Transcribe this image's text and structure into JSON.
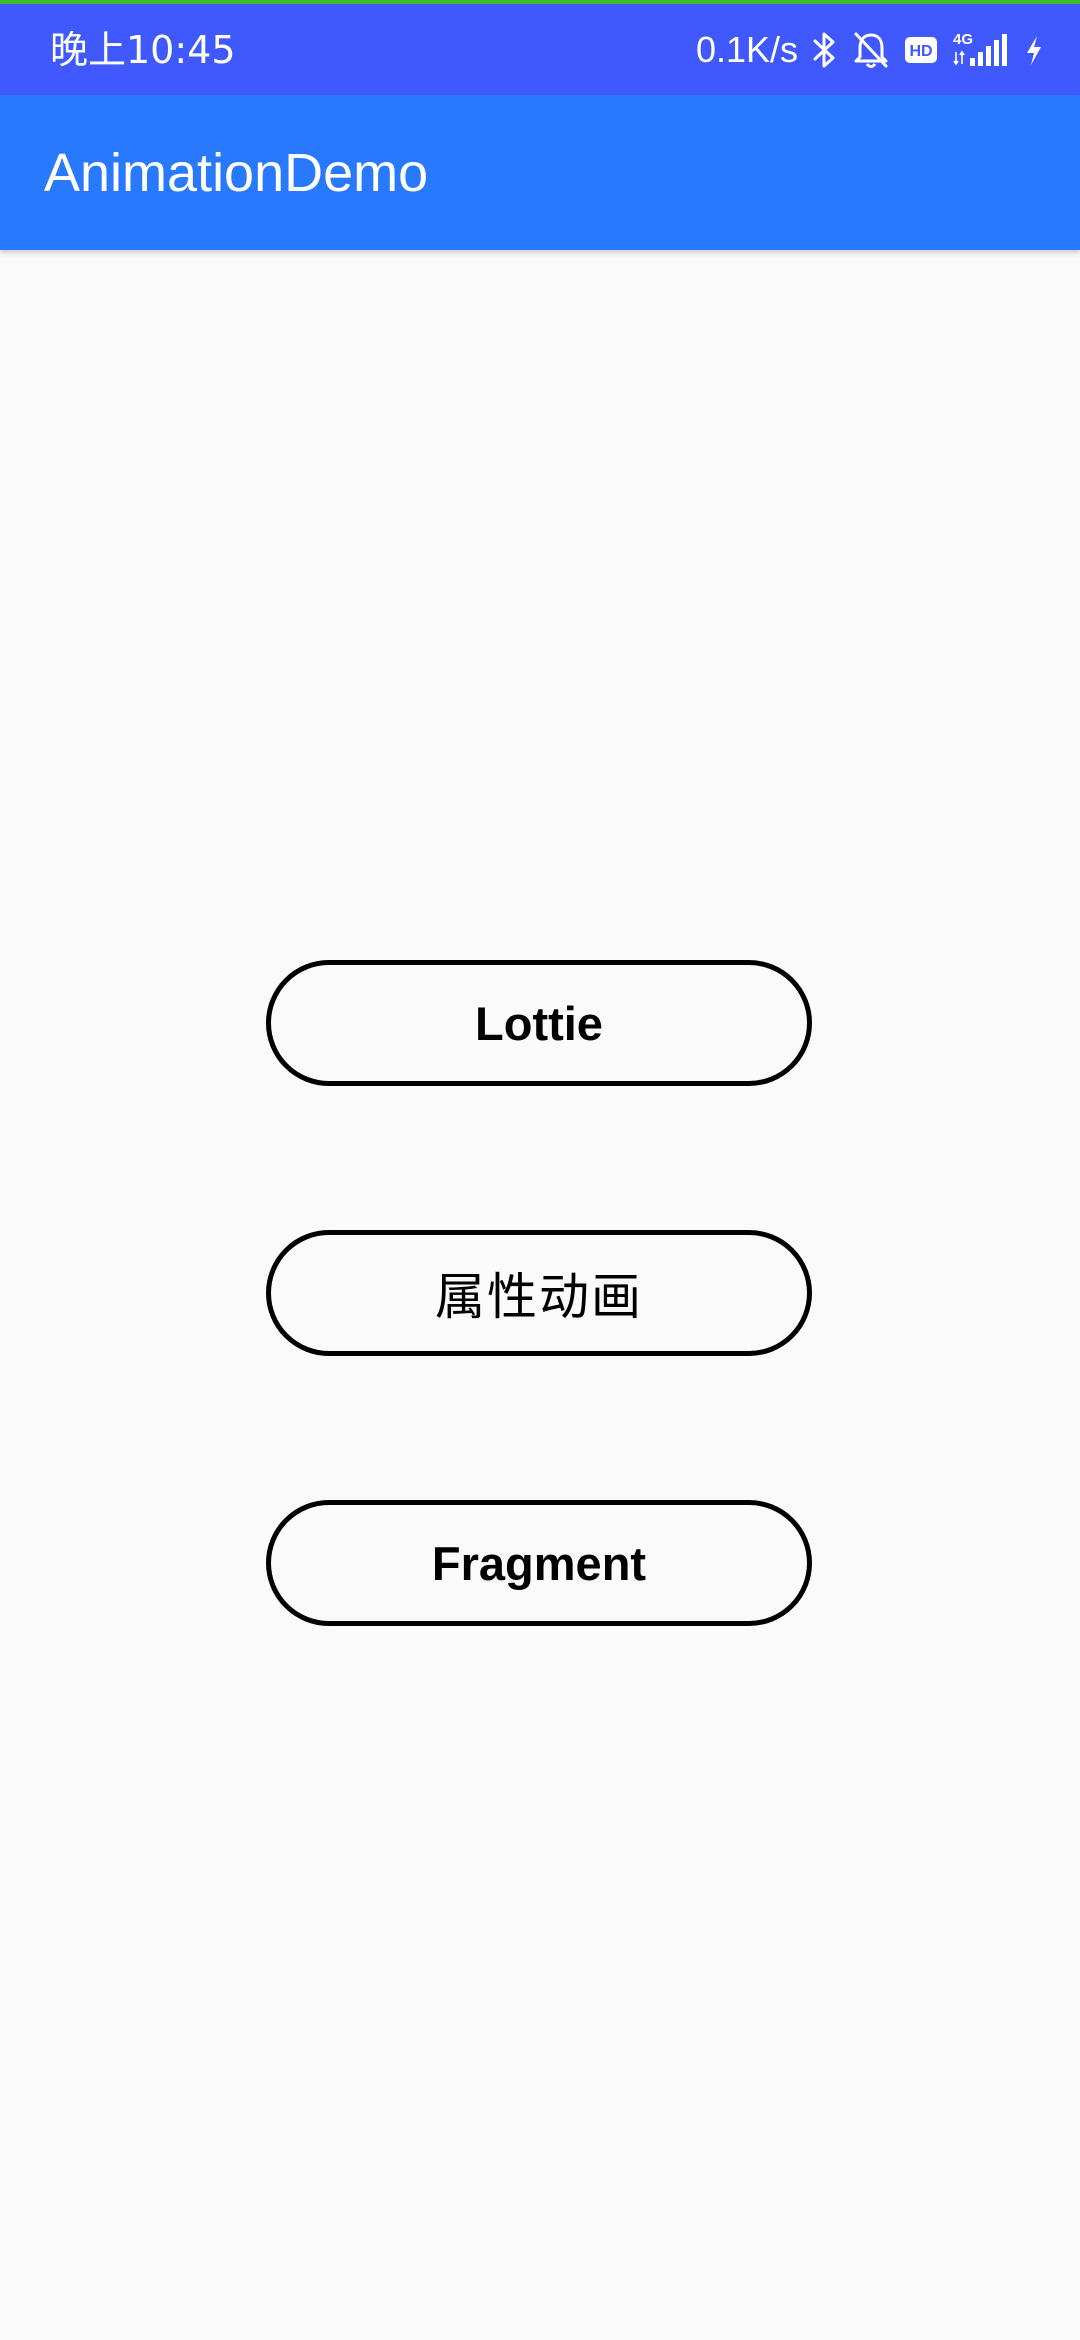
{
  "status_bar": {
    "time": "晚上10:45",
    "net_speed": "0.1K/s",
    "icons": [
      "bluetooth-icon",
      "mute-bell-icon",
      "hd-icon",
      "signal-4g-icon",
      "charging-icon"
    ],
    "hd_label": "HD",
    "network_label": "4G",
    "background": "#4059ff"
  },
  "app_bar": {
    "title": "AnimationDemo",
    "background": "#2979ff"
  },
  "buttons": {
    "lottie": "Lottie",
    "property_animation": "属性动画",
    "fragment": "Fragment"
  },
  "colors": {
    "accent_strip": "#3cbf2a",
    "page_background": "#fafafa",
    "button_border": "#000000"
  }
}
